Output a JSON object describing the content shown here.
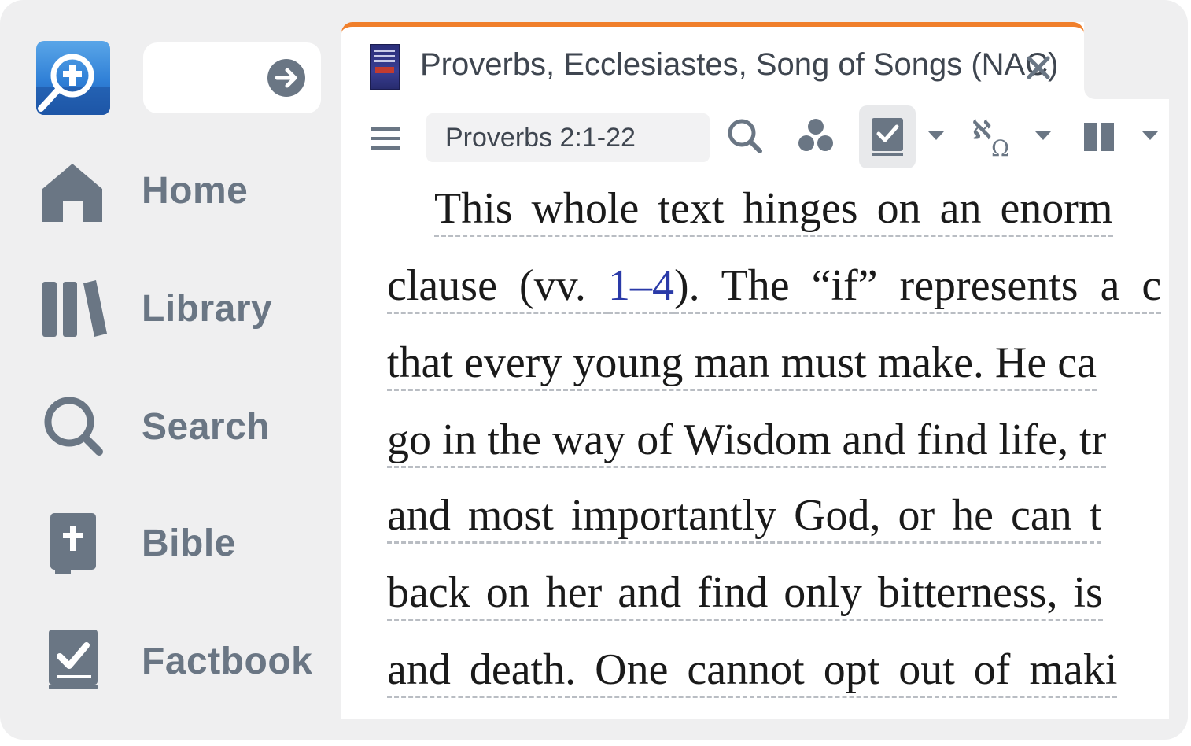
{
  "sidebar": {
    "logo": "logos-app-logo",
    "go_button_icon": "arrow-right-circle-icon",
    "items": [
      {
        "label": "Home",
        "icon": "home-icon"
      },
      {
        "label": "Library",
        "icon": "library-icon"
      },
      {
        "label": "Search",
        "icon": "search-icon"
      },
      {
        "label": "Bible",
        "icon": "bible-icon"
      },
      {
        "label": "Factbook",
        "icon": "factbook-icon"
      }
    ]
  },
  "tab": {
    "title": "Proverbs, Ecclesiastes, Song of Songs (NAC)",
    "close_icon": "close-icon",
    "accent_color": "#f07f2b"
  },
  "toolbar": {
    "menu_icon": "hamburger-menu-icon",
    "reference": "Proverbs 2:1-22",
    "tools": [
      "search-icon",
      "visual-filters-icon",
      "factbook-icon",
      "interlinear-icon",
      "parallel-columns-icon"
    ]
  },
  "content": {
    "lines": [
      {
        "pre": "This whole text hinges on an enorm",
        "ref": "",
        "post": ""
      },
      {
        "pre": "clause (vv. ",
        "ref": "1–4",
        "post": "). The “if” represents a c"
      },
      {
        "pre": "that every young man must make. He ca",
        "ref": "",
        "post": ""
      },
      {
        "pre": "go in the way of Wisdom and find life, tr",
        "ref": "",
        "post": ""
      },
      {
        "pre": "and most importantly God, or he can t",
        "ref": "",
        "post": ""
      },
      {
        "pre": "back on her and find only bitterness, is",
        "ref": "",
        "post": ""
      },
      {
        "pre": "and death. One cannot opt out of maki",
        "ref": "",
        "post": ""
      }
    ]
  }
}
